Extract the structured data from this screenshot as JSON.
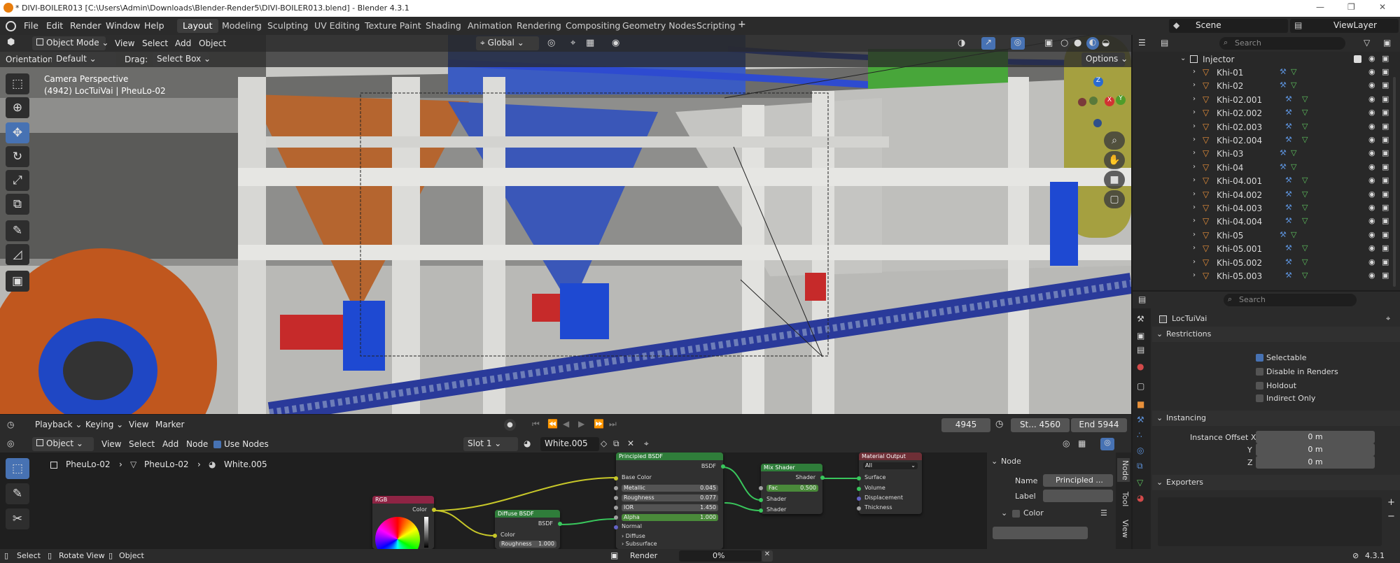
{
  "titlebar": {
    "title": "* DIVI-BOILER013 [C:\\Users\\Admin\\Downloads\\Blender-Render5\\DIVI-BOILER013.blend] - Blender 4.3.1"
  },
  "menu": {
    "file": "File",
    "edit": "Edit",
    "render": "Render",
    "window": "Window",
    "help": "Help"
  },
  "workspaces": [
    "Layout",
    "Modeling",
    "Sculpting",
    "UV Editing",
    "Texture Paint",
    "Shading",
    "Animation",
    "Rendering",
    "Compositing",
    "Geometry Nodes",
    "Scripting"
  ],
  "workspace_add": "+",
  "scene": {
    "name": "Scene",
    "view_layer": "ViewLayer"
  },
  "viewport": {
    "mode": "Object Mode",
    "menus": [
      "View",
      "Select",
      "Add",
      "Object"
    ],
    "transform_orientation": "Global",
    "orientation_label": "Orientation:",
    "orientation_value": "Default",
    "drag_label": "Drag:",
    "drag_value": "Select Box",
    "options": "Options",
    "camera_label": "Camera Perspective",
    "object_info": "(4942) LocTuiVai | PheuLo-02",
    "gizmo": {
      "z": "Z",
      "x": "X",
      "y": "Y"
    }
  },
  "outliner": {
    "search_placeholder": "Search",
    "collection": "Injector",
    "items": [
      "Khi-01",
      "Khi-02",
      "Khi-02.001",
      "Khi-02.002",
      "Khi-02.003",
      "Khi-02.004",
      "Khi-03",
      "Khi-04",
      "Khi-04.001",
      "Khi-04.002",
      "Khi-04.003",
      "Khi-04.004",
      "Khi-05",
      "Khi-05.001",
      "Khi-05.002",
      "Khi-05.003"
    ]
  },
  "properties": {
    "search_placeholder": "Search",
    "object_name": "LocTuiVai",
    "restrictions": {
      "title": "Restrictions",
      "selectable": "Selectable",
      "disable_renders": "Disable in Renders",
      "holdout": "Holdout",
      "indirect_only": "Indirect Only"
    },
    "instancing": {
      "title": "Instancing",
      "offset_x_label": "Instance Offset X",
      "y_label": "Y",
      "z_label": "Z",
      "x_value": "0 m",
      "y_value": "0 m",
      "z_value": "0 m"
    },
    "exporters": {
      "title": "Exporters"
    }
  },
  "timeline": {
    "menus": [
      "Playback",
      "Keying",
      "View",
      "Marker"
    ],
    "current_frame": "4945",
    "start": "St... 4560",
    "end": "End 5944"
  },
  "node_editor": {
    "type": "Object",
    "menus": [
      "View",
      "Select",
      "Add",
      "Node"
    ],
    "use_nodes": "Use Nodes",
    "slot": "Slot 1",
    "material": "White.005",
    "breadcrumb": [
      "PheuLo-02",
      "PheuLo-02",
      "White.005"
    ],
    "side_panel": {
      "tab_node": "Node",
      "tab_tool": "Tool",
      "tab_view": "View",
      "section": "Node",
      "name_label": "Name",
      "name_value": "Principled ...",
      "label_label": "Label",
      "color_section": "Color"
    },
    "nodes": {
      "rgb": {
        "title": "RGB",
        "output": "Color"
      },
      "diffuse": {
        "title": "Diffuse BSDF",
        "output": "BSDF",
        "color": "Color",
        "roughness": "Roughness",
        "roughness_val": "1.000"
      },
      "principled": {
        "title": "Principled BSDF",
        "output": "BSDF",
        "base_color": "Base Color",
        "metallic": "Metallic",
        "metallic_val": "0.045",
        "roughness": "Roughness",
        "roughness_val": "0.077",
        "ior": "IOR",
        "ior_val": "1.450",
        "alpha": "Alpha",
        "alpha_val": "1.000",
        "normal": "Normal",
        "diffuse": "Diffuse",
        "subsurface": "Subsurface"
      },
      "mix": {
        "title": "Mix Shader",
        "output": "Shader",
        "fac": "Fac",
        "fac_val": "0.500",
        "shader1": "Shader",
        "shader2": "Shader"
      },
      "output": {
        "title": "Material Output",
        "target": "All",
        "surface": "Surface",
        "volume": "Volume",
        "displacement": "Displacement",
        "thickness": "Thickness"
      }
    }
  },
  "statusbar": {
    "select": "Select",
    "rotate": "Rotate View",
    "object": "Object",
    "render": "Render",
    "progress": "0%",
    "progress_value": 0,
    "version": "4.3.1"
  },
  "colors": {
    "accent": "#4772b3",
    "selected_outline": "#e8903a",
    "node_shader_header": "#2f7d3a",
    "node_output_header": "#6e2f36",
    "node_input_header": "#8e2444"
  }
}
